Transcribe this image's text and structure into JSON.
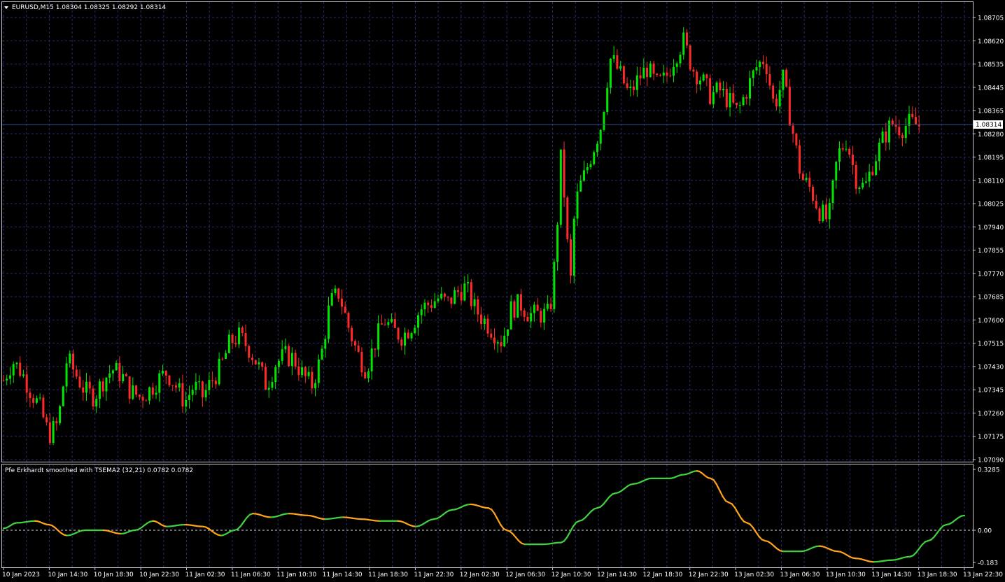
{
  "window": {
    "symbol_title": "EURUSD,M15  1.08304 1.08325 1.08292 1.08314",
    "indicator_title": "Pfe Erkhardt smoothed with TSEMA2 (32,21) 0.0782 0.0782"
  },
  "colors": {
    "background": "#000000",
    "grid": "#2b2b6b",
    "bull": "#00e600",
    "bear": "#ff2a2a",
    "ind_up": "#3fd13f",
    "ind_down": "#ffa31a",
    "axis_text": "#ffffff",
    "price_tag_bg": "#ffffff",
    "price_tag_text": "#000000"
  },
  "price_axis": {
    "labels": [
      "1.08705",
      "1.08620",
      "1.08535",
      "1.08445",
      "1.08365",
      "1.08280",
      "1.08195",
      "1.08110",
      "1.08025",
      "1.07940",
      "1.07855",
      "1.07770",
      "1.07685",
      "1.07600",
      "1.07515",
      "1.07430",
      "1.07345",
      "1.07260",
      "1.07175",
      "1.07090"
    ],
    "min": 1.0709,
    "max": 1.08705,
    "current_price": "1.08314"
  },
  "indicator_axis": {
    "labels": [
      "0.3285",
      "0.00",
      "-0.183"
    ],
    "values": [
      0.3285,
      0.0,
      -0.183
    ]
  },
  "time_axis": {
    "labels": [
      "10 Jan 2023",
      "10 Jan 14:30",
      "10 Jan 18:30",
      "10 Jan 22:30",
      "11 Jan 02:30",
      "11 Jan 06:30",
      "11 Jan 10:30",
      "11 Jan 14:30",
      "11 Jan 18:30",
      "11 Jan 22:30",
      "12 Jan 02:30",
      "12 Jan 06:30",
      "12 Jan 10:30",
      "12 Jan 14:30",
      "12 Jan 18:30",
      "12 Jan 22:30",
      "13 Jan 02:30",
      "13 Jan 06:30",
      "13 Jan 10:30",
      "13 Jan 14:30",
      "13 Jan 18:30",
      "13 Jan 22:30"
    ]
  },
  "chart_data": [
    {
      "type": "candlestick",
      "title": "EURUSD,M15",
      "ylim": [
        1.0709,
        1.08705
      ],
      "close_path": [
        {
          "t": 0,
          "p": 1.0738
        },
        {
          "t": 2,
          "p": 1.0745
        },
        {
          "t": 4,
          "p": 1.0741
        },
        {
          "t": 6,
          "p": 1.0734
        },
        {
          "t": 8,
          "p": 1.0728
        },
        {
          "t": 10,
          "p": 1.0718
        },
        {
          "t": 12,
          "p": 1.0722
        },
        {
          "t": 14,
          "p": 1.0746
        },
        {
          "t": 16,
          "p": 1.074
        },
        {
          "t": 18,
          "p": 1.0734
        },
        {
          "t": 20,
          "p": 1.0732
        },
        {
          "t": 22,
          "p": 1.0738
        },
        {
          "t": 24,
          "p": 1.0742
        },
        {
          "t": 26,
          "p": 1.074
        },
        {
          "t": 28,
          "p": 1.0734
        },
        {
          "t": 30,
          "p": 1.0732
        },
        {
          "t": 32,
          "p": 1.0734
        },
        {
          "t": 34,
          "p": 1.0738
        },
        {
          "t": 36,
          "p": 1.0741
        },
        {
          "t": 38,
          "p": 1.0736
        },
        {
          "t": 40,
          "p": 1.073
        },
        {
          "t": 42,
          "p": 1.0736
        },
        {
          "t": 44,
          "p": 1.0732
        },
        {
          "t": 46,
          "p": 1.0738
        },
        {
          "t": 48,
          "p": 1.0743
        },
        {
          "t": 50,
          "p": 1.0752
        },
        {
          "t": 52,
          "p": 1.0754
        },
        {
          "t": 54,
          "p": 1.075
        },
        {
          "t": 56,
          "p": 1.0744
        },
        {
          "t": 58,
          "p": 1.0736
        },
        {
          "t": 60,
          "p": 1.0744
        },
        {
          "t": 62,
          "p": 1.0747
        },
        {
          "t": 64,
          "p": 1.0746
        },
        {
          "t": 66,
          "p": 1.074
        },
        {
          "t": 68,
          "p": 1.0736
        },
        {
          "t": 70,
          "p": 1.0746
        },
        {
          "t": 72,
          "p": 1.0766
        },
        {
          "t": 74,
          "p": 1.077
        },
        {
          "t": 76,
          "p": 1.0758
        },
        {
          "t": 78,
          "p": 1.0748
        },
        {
          "t": 80,
          "p": 1.0742
        },
        {
          "t": 82,
          "p": 1.0752
        },
        {
          "t": 84,
          "p": 1.076
        },
        {
          "t": 86,
          "p": 1.0756
        },
        {
          "t": 88,
          "p": 1.0754
        },
        {
          "t": 90,
          "p": 1.0758
        },
        {
          "t": 92,
          "p": 1.0764
        },
        {
          "t": 94,
          "p": 1.0766
        },
        {
          "t": 96,
          "p": 1.0768
        },
        {
          "t": 98,
          "p": 1.0766
        },
        {
          "t": 100,
          "p": 1.077
        },
        {
          "t": 102,
          "p": 1.0772
        },
        {
          "t": 104,
          "p": 1.0764
        },
        {
          "t": 106,
          "p": 1.076
        },
        {
          "t": 108,
          "p": 1.0756
        },
        {
          "t": 110,
          "p": 1.0752
        },
        {
          "t": 112,
          "p": 1.0764
        },
        {
          "t": 114,
          "p": 1.0766
        },
        {
          "t": 116,
          "p": 1.0762
        },
        {
          "t": 118,
          "p": 1.0762
        },
        {
          "t": 120,
          "p": 1.0762
        },
        {
          "t": 121,
          "p": 1.0768
        },
        {
          "t": 122,
          "p": 1.079
        },
        {
          "t": 123,
          "p": 1.082
        },
        {
          "t": 124,
          "p": 1.08
        },
        {
          "t": 125,
          "p": 1.077
        },
        {
          "t": 126,
          "p": 1.08
        },
        {
          "t": 127,
          "p": 1.0808
        },
        {
          "t": 128,
          "p": 1.0812
        },
        {
          "t": 130,
          "p": 1.0822
        },
        {
          "t": 132,
          "p": 1.0832
        },
        {
          "t": 133,
          "p": 1.0846
        },
        {
          "t": 134,
          "p": 1.0856
        },
        {
          "t": 136,
          "p": 1.085
        },
        {
          "t": 138,
          "p": 1.0842
        },
        {
          "t": 140,
          "p": 1.0848
        },
        {
          "t": 142,
          "p": 1.0852
        },
        {
          "t": 144,
          "p": 1.0846
        },
        {
          "t": 146,
          "p": 1.0848
        },
        {
          "t": 148,
          "p": 1.0856
        },
        {
          "t": 150,
          "p": 1.0862
        },
        {
          "t": 152,
          "p": 1.0852
        },
        {
          "t": 154,
          "p": 1.0848
        },
        {
          "t": 156,
          "p": 1.0842
        },
        {
          "t": 158,
          "p": 1.0844
        },
        {
          "t": 160,
          "p": 1.084
        },
        {
          "t": 162,
          "p": 1.0836
        },
        {
          "t": 164,
          "p": 1.0844
        },
        {
          "t": 166,
          "p": 1.0852
        },
        {
          "t": 168,
          "p": 1.0856
        },
        {
          "t": 170,
          "p": 1.0838
        },
        {
          "t": 172,
          "p": 1.0848
        },
        {
          "t": 174,
          "p": 1.083
        },
        {
          "t": 176,
          "p": 1.0812
        },
        {
          "t": 178,
          "p": 1.0808
        },
        {
          "t": 180,
          "p": 1.08
        },
        {
          "t": 182,
          "p": 1.0796
        },
        {
          "t": 184,
          "p": 1.082
        },
        {
          "t": 186,
          "p": 1.0826
        },
        {
          "t": 188,
          "p": 1.0812
        },
        {
          "t": 190,
          "p": 1.0808
        },
        {
          "t": 192,
          "p": 1.0818
        },
        {
          "t": 194,
          "p": 1.0826
        },
        {
          "t": 196,
          "p": 1.0832
        },
        {
          "t": 198,
          "p": 1.083
        },
        {
          "t": 200,
          "p": 1.0832
        },
        {
          "t": 202,
          "p": 1.0831
        }
      ]
    },
    {
      "type": "line",
      "title": "Pfe Erkhardt smoothed with TSEMA2 (32,21)",
      "ylim": [
        -0.183,
        0.3285
      ],
      "series": [
        {
          "values": [
            {
              "t": 0,
              "v": 0.01
            },
            {
              "t": 3,
              "v": 0.04
            },
            {
              "t": 7,
              "v": 0.05
            },
            {
              "t": 10,
              "v": 0.03
            },
            {
              "t": 14,
              "v": -0.03
            },
            {
              "t": 18,
              "v": 0.0
            },
            {
              "t": 22,
              "v": 0.0
            },
            {
              "t": 26,
              "v": -0.02
            },
            {
              "t": 29,
              "v": 0.0
            },
            {
              "t": 33,
              "v": 0.05
            },
            {
              "t": 36,
              "v": 0.02
            },
            {
              "t": 40,
              "v": 0.03
            },
            {
              "t": 44,
              "v": 0.02
            },
            {
              "t": 48,
              "v": -0.03
            },
            {
              "t": 51,
              "v": 0.0
            },
            {
              "t": 55,
              "v": 0.09
            },
            {
              "t": 59,
              "v": 0.07
            },
            {
              "t": 63,
              "v": 0.09
            },
            {
              "t": 67,
              "v": 0.08
            },
            {
              "t": 71,
              "v": 0.06
            },
            {
              "t": 75,
              "v": 0.07
            },
            {
              "t": 79,
              "v": 0.06
            },
            {
              "t": 83,
              "v": 0.05
            },
            {
              "t": 87,
              "v": 0.05
            },
            {
              "t": 91,
              "v": 0.02
            },
            {
              "t": 95,
              "v": 0.06
            },
            {
              "t": 99,
              "v": 0.11
            },
            {
              "t": 103,
              "v": 0.14
            },
            {
              "t": 107,
              "v": 0.12
            },
            {
              "t": 111,
              "v": 0.0
            },
            {
              "t": 115,
              "v": -0.08
            },
            {
              "t": 119,
              "v": -0.08
            },
            {
              "t": 123,
              "v": -0.07
            },
            {
              "t": 127,
              "v": 0.05
            },
            {
              "t": 131,
              "v": 0.12
            },
            {
              "t": 135,
              "v": 0.2
            },
            {
              "t": 139,
              "v": 0.25
            },
            {
              "t": 143,
              "v": 0.28
            },
            {
              "t": 147,
              "v": 0.28
            },
            {
              "t": 150,
              "v": 0.3
            },
            {
              "t": 153,
              "v": 0.32
            },
            {
              "t": 156,
              "v": 0.28
            },
            {
              "t": 160,
              "v": 0.15
            },
            {
              "t": 164,
              "v": 0.04
            },
            {
              "t": 168,
              "v": -0.06
            },
            {
              "t": 172,
              "v": -0.12
            },
            {
              "t": 176,
              "v": -0.12
            },
            {
              "t": 180,
              "v": -0.09
            },
            {
              "t": 184,
              "v": -0.12
            },
            {
              "t": 188,
              "v": -0.16
            },
            {
              "t": 192,
              "v": -0.18
            },
            {
              "t": 196,
              "v": -0.17
            },
            {
              "t": 200,
              "v": -0.15
            },
            {
              "t": 204,
              "v": -0.06
            },
            {
              "t": 208,
              "v": 0.03
            },
            {
              "t": 212,
              "v": 0.08
            }
          ]
        }
      ]
    }
  ]
}
